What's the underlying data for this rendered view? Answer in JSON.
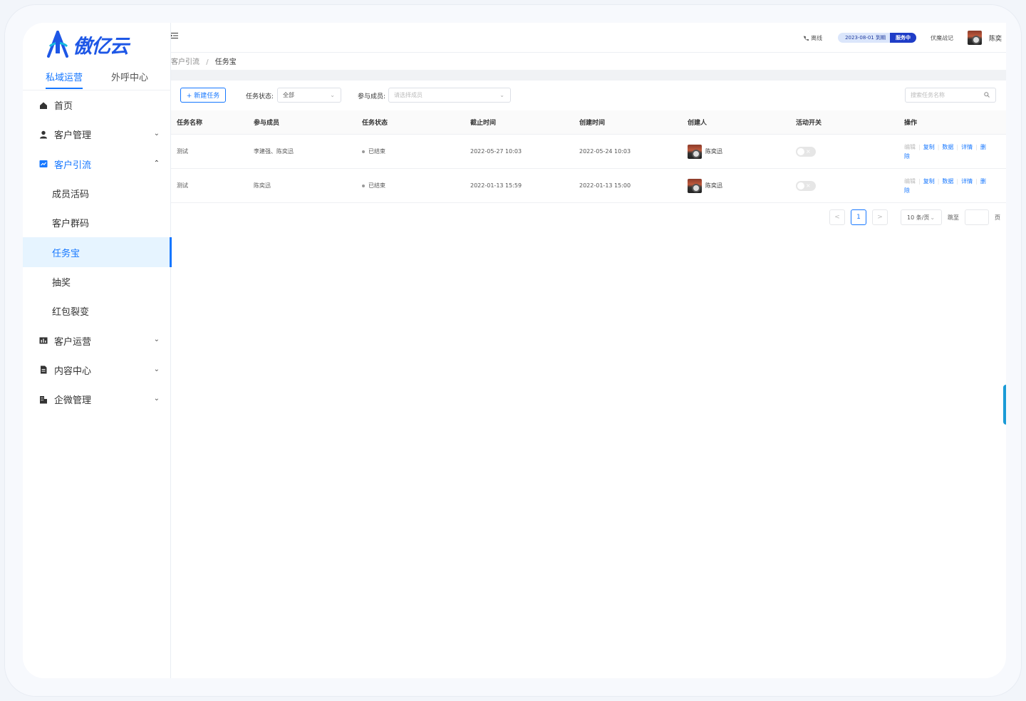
{
  "brand": {
    "name": "傲亿云",
    "color": "#1e57e6"
  },
  "top_tabs": [
    {
      "label": "私域运营",
      "active": true
    },
    {
      "label": "外呼中心",
      "active": false
    }
  ],
  "menu": {
    "home": "首页",
    "customer_mgmt": "客户管理",
    "customer_acq": "客户引流",
    "acq_sub": [
      "成员活码",
      "客户群码",
      "任务宝",
      "抽奖",
      "红包裂变"
    ],
    "customer_ops": "客户运营",
    "content_center": "内容中心",
    "wecom_mgmt": "企微管理"
  },
  "header": {
    "fold_icon": "menu-fold-icon",
    "call_status": "离线",
    "expire": "2023-08-01 到期",
    "service_status": "服务中",
    "note": "伏魔战记",
    "user_name": "陈奕"
  },
  "breadcrumb": {
    "parent": "客户引流",
    "separator": "/",
    "current": "任务宝"
  },
  "toolbar": {
    "new_task": "+ 新建任务",
    "status_label": "任务状态:",
    "status_value": "全部",
    "member_label": "参与成员:",
    "member_placeholder": "请选择成员",
    "search_placeholder": "搜索任务名称"
  },
  "table": {
    "columns": [
      "任务名称",
      "参与成员",
      "任务状态",
      "截止时间",
      "创建时间",
      "创建人",
      "活动开关",
      "操作"
    ],
    "rows": [
      {
        "name": "测试",
        "members": "李建强、陈奕迅",
        "status": "已结束",
        "deadline": "2022-05-27 10:03",
        "created": "2022-05-24 10:03",
        "creator": "陈奕迅"
      },
      {
        "name": "测试",
        "members": "陈奕迅",
        "status": "已结束",
        "deadline": "2022-01-13 15:59",
        "created": "2022-01-13 15:00",
        "creator": "陈奕迅"
      }
    ],
    "ops": {
      "edit": "编辑",
      "copy": "复制",
      "data": "数据",
      "detail": "详情",
      "delete_1": "删",
      "delete_2": "除"
    }
  },
  "pager": {
    "prev": "<",
    "current": "1",
    "next": ">",
    "size": "10 条/页",
    "jump_label": "跳至",
    "page_label": "页"
  },
  "colors": {
    "accent": "#1677ff",
    "service": "#1f3dc7"
  }
}
